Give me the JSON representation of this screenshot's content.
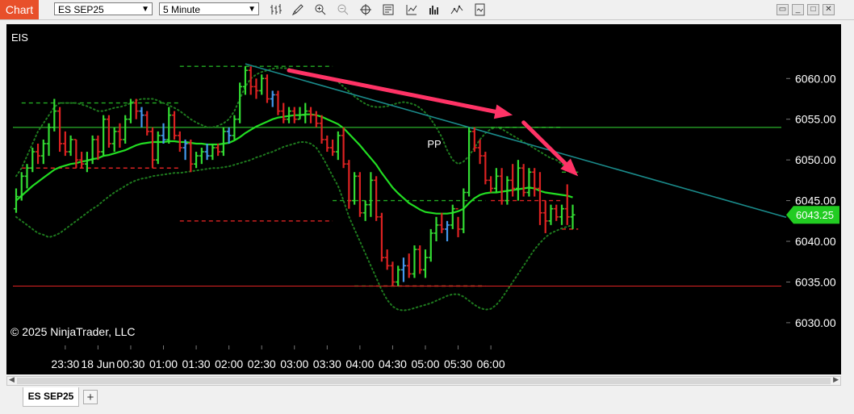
{
  "app": {
    "title": "Chart"
  },
  "toolbar": {
    "instrument": "ES SEP25",
    "period": "5 Minute",
    "icons": [
      "bar-type-icon",
      "drawing-tool-icon",
      "zoom-in-icon",
      "zoom-out-icon",
      "crosshair-icon",
      "data-box-icon",
      "indicators-icon",
      "strategies-icon",
      "chart-trader-icon",
      "templates-icon"
    ],
    "window_buttons": [
      "restore-icon",
      "minimize-icon",
      "maximize-icon",
      "close-icon"
    ]
  },
  "chart": {
    "instrument_label": "EIS",
    "copyright": "© 2025 NinjaTrader, LLC",
    "current_price": "6043.25",
    "pp_label": "PP",
    "colors": {
      "up": "#33dd33",
      "down": "#dd2222",
      "neutral": "#4499ee",
      "sma": "#22dd22",
      "bands": "#1e7a1e",
      "trend": "#1a8a8a",
      "arrow": "#ff3366",
      "price_marker": "#22cc22"
    }
  },
  "chart_data": {
    "type": "candlestick",
    "instrument": "ES SEP25",
    "interval": "5 Minute",
    "x_tick_labels": [
      "23:30",
      "18 Jun",
      "00:30",
      "01:00",
      "01:30",
      "02:00",
      "02:30",
      "03:00",
      "03:30",
      "04:00",
      "04:30",
      "05:00",
      "05:30",
      "06:00"
    ],
    "y_ticks": [
      6030.0,
      6035.0,
      6040.0,
      6045.0,
      6050.0,
      6055.0,
      6060.0
    ],
    "y_tick_labels": [
      "6030.00",
      "6035.00",
      "6040.00",
      "6045.00",
      "6050.00",
      "6055.00",
      "6060.00"
    ],
    "ylim": [
      6028.5,
      6063.5
    ],
    "horizontal_lines": [
      {
        "price": 6054.0,
        "color": "#33dd33",
        "style": "solid"
      },
      {
        "price": 6034.5,
        "color": "#dd2222",
        "style": "solid"
      }
    ],
    "ohlc": [
      [
        6044.0,
        6046.5,
        6043.5,
        6045.5
      ],
      [
        6045.5,
        6048.5,
        6045.0,
        6048.0
      ],
      [
        6048.0,
        6049.5,
        6046.5,
        6049.0
      ],
      [
        6049.0,
        6051.5,
        6048.5,
        6051.0
      ],
      [
        6051.0,
        6052.0,
        6049.5,
        6050.5
      ],
      [
        6050.5,
        6052.5,
        6049.5,
        6052.0
      ],
      [
        6052.0,
        6054.5,
        6050.5,
        6054.0
      ],
      [
        6054.0,
        6057.5,
        6053.5,
        6056.0
      ],
      [
        6056.0,
        6056.5,
        6051.0,
        6052.0
      ],
      [
        6052.0,
        6053.5,
        6050.5,
        6051.0
      ],
      [
        6051.0,
        6053.0,
        6050.5,
        6052.5
      ],
      [
        6052.5,
        6052.5,
        6049.0,
        6050.0
      ],
      [
        6050.0,
        6051.0,
        6049.0,
        6049.5
      ],
      [
        6049.5,
        6051.0,
        6048.5,
        6050.0
      ],
      [
        6050.0,
        6053.0,
        6049.5,
        6052.5
      ],
      [
        6052.5,
        6053.0,
        6050.0,
        6051.0
      ],
      [
        6051.0,
        6055.5,
        6050.5,
        6055.0
      ],
      [
        6055.0,
        6055.5,
        6051.5,
        6052.0
      ],
      [
        6052.0,
        6054.0,
        6051.0,
        6053.5
      ],
      [
        6053.5,
        6054.5,
        6051.5,
        6052.5
      ],
      [
        6052.5,
        6055.5,
        6052.0,
        6055.0
      ],
      [
        6055.0,
        6057.5,
        6054.5,
        6057.0
      ],
      [
        6057.0,
        6057.5,
        6055.0,
        6056.0
      ],
      [
        6056.0,
        6056.5,
        6054.0,
        6055.5
      ],
      [
        6055.5,
        6056.0,
        6053.0,
        6053.5
      ],
      [
        6053.5,
        6054.0,
        6049.0,
        6050.0
      ],
      [
        6050.0,
        6053.5,
        6049.5,
        6053.0
      ],
      [
        6053.0,
        6054.5,
        6052.0,
        6052.5
      ],
      [
        6052.5,
        6056.5,
        6052.0,
        6055.5
      ],
      [
        6055.5,
        6056.0,
        6052.5,
        6053.0
      ],
      [
        6053.0,
        6053.5,
        6051.0,
        6051.5
      ],
      [
        6051.5,
        6052.5,
        6050.0,
        6052.0
      ],
      [
        6052.0,
        6052.5,
        6048.5,
        6049.5
      ],
      [
        6049.5,
        6051.0,
        6049.0,
        6050.5
      ],
      [
        6050.5,
        6051.5,
        6049.5,
        6051.0
      ],
      [
        6051.0,
        6052.0,
        6050.0,
        6050.5
      ],
      [
        6050.5,
        6052.0,
        6050.0,
        6051.5
      ],
      [
        6051.5,
        6052.0,
        6050.5,
        6051.0
      ],
      [
        6051.0,
        6054.0,
        6050.5,
        6053.5
      ],
      [
        6053.5,
        6054.0,
        6052.0,
        6053.0
      ],
      [
        6053.0,
        6055.5,
        6052.5,
        6055.0
      ],
      [
        6055.0,
        6059.5,
        6054.5,
        6059.0
      ],
      [
        6059.0,
        6061.5,
        6058.0,
        6061.0
      ],
      [
        6061.0,
        6061.5,
        6058.0,
        6059.0
      ],
      [
        6059.0,
        6060.0,
        6057.5,
        6058.5
      ],
      [
        6058.5,
        6060.5,
        6058.0,
        6060.0
      ],
      [
        6060.0,
        6060.5,
        6057.0,
        6057.5
      ],
      [
        6057.5,
        6058.5,
        6056.5,
        6058.0
      ],
      [
        6058.0,
        6058.5,
        6055.5,
        6056.0
      ],
      [
        6056.0,
        6057.0,
        6054.5,
        6055.0
      ],
      [
        6055.0,
        6056.5,
        6054.5,
        6056.0
      ],
      [
        6056.0,
        6056.5,
        6054.5,
        6055.0
      ],
      [
        6055.0,
        6056.5,
        6055.0,
        6055.5
      ],
      [
        6055.5,
        6057.0,
        6054.5,
        6056.0
      ],
      [
        6056.0,
        6056.5,
        6054.5,
        6055.5
      ],
      [
        6055.5,
        6056.0,
        6054.0,
        6054.5
      ],
      [
        6054.5,
        6055.5,
        6052.0,
        6052.5
      ],
      [
        6052.5,
        6053.0,
        6051.0,
        6051.5
      ],
      [
        6051.5,
        6052.5,
        6050.5,
        6051.0
      ],
      [
        6051.0,
        6053.5,
        6050.0,
        6053.0
      ],
      [
        6053.0,
        6054.0,
        6049.0,
        6049.5
      ],
      [
        6049.5,
        6050.0,
        6044.0,
        6045.0
      ],
      [
        6045.0,
        6048.5,
        6044.5,
        6048.0
      ],
      [
        6048.0,
        6048.5,
        6043.0,
        6043.5
      ],
      [
        6043.5,
        6045.0,
        6042.5,
        6044.5
      ],
      [
        6044.5,
        6048.5,
        6043.0,
        6047.5
      ],
      [
        6047.5,
        6048.0,
        6042.5,
        6043.0
      ],
      [
        6043.0,
        6043.5,
        6037.5,
        6038.0
      ],
      [
        6038.0,
        6039.0,
        6036.5,
        6037.0
      ],
      [
        6037.0,
        6037.5,
        6034.5,
        6035.0
      ],
      [
        6035.0,
        6037.0,
        6034.5,
        6036.5
      ],
      [
        6036.5,
        6038.0,
        6035.0,
        6037.0
      ],
      [
        6037.0,
        6038.5,
        6035.5,
        6036.0
      ],
      [
        6036.0,
        6039.5,
        6035.5,
        6039.0
      ],
      [
        6039.0,
        6039.5,
        6036.0,
        6036.5
      ],
      [
        6036.5,
        6039.0,
        6035.5,
        6038.0
      ],
      [
        6038.0,
        6041.5,
        6037.5,
        6041.0
      ],
      [
        6041.0,
        6043.0,
        6040.0,
        6042.0
      ],
      [
        6042.0,
        6043.5,
        6041.0,
        6041.5
      ],
      [
        6041.5,
        6042.5,
        6040.0,
        6042.0
      ],
      [
        6042.0,
        6044.5,
        6041.5,
        6044.0
      ],
      [
        6044.0,
        6043.0,
        6040.5,
        6041.5
      ],
      [
        6041.5,
        6046.5,
        6041.0,
        6046.0
      ],
      [
        6046.0,
        6054.0,
        6045.5,
        6053.5
      ],
      [
        6053.5,
        6054.0,
        6051.0,
        6051.5
      ],
      [
        6051.5,
        6052.5,
        6049.5,
        6050.5
      ],
      [
        6050.5,
        6051.0,
        6047.0,
        6047.5
      ],
      [
        6047.5,
        6048.0,
        6046.0,
        6046.5
      ],
      [
        6046.5,
        6049.0,
        6046.0,
        6048.0
      ],
      [
        6048.0,
        6049.0,
        6044.5,
        6045.0
      ],
      [
        6045.0,
        6048.0,
        6044.5,
        6047.5
      ],
      [
        6047.5,
        6049.5,
        6045.5,
        6046.5
      ],
      [
        6046.5,
        6050.0,
        6045.0,
        6049.0
      ],
      [
        6049.0,
        6049.5,
        6045.5,
        6046.0
      ],
      [
        6046.0,
        6049.0,
        6045.5,
        6048.5
      ],
      [
        6048.5,
        6049.0,
        6045.5,
        6046.5
      ],
      [
        6046.5,
        6048.5,
        6042.0,
        6043.5
      ],
      [
        6043.5,
        6045.0,
        6041.0,
        6042.5
      ],
      [
        6042.5,
        6044.5,
        6042.0,
        6044.0
      ],
      [
        6044.0,
        6044.5,
        6042.5,
        6043.0
      ],
      [
        6043.0,
        6044.5,
        6042.0,
        6044.0
      ],
      [
        6044.0,
        6047.0,
        6042.0,
        6043.0
      ],
      [
        6043.0,
        6044.5,
        6041.5,
        6043.25
      ]
    ],
    "sma": [
      6045.0,
      6045.6,
      6046.2,
      6046.8,
      6047.3,
      6047.8,
      6048.3,
      6048.8,
      6049.1,
      6049.3,
      6049.5,
      6049.6,
      6049.8,
      6049.9,
      6050.1,
      6050.2,
      6050.5,
      6050.6,
      6050.8,
      6051.0,
      6051.2,
      6051.5,
      6051.8,
      6052.0,
      6052.1,
      6052.2,
      6052.2,
      6052.2,
      6052.3,
      6052.3,
      6052.2,
      6052.2,
      6052.1,
      6052.0,
      6052.0,
      6051.9,
      6051.9,
      6051.9,
      6052.0,
      6052.1,
      6052.4,
      6052.8,
      6053.3,
      6053.7,
      6054.1,
      6054.4,
      6054.7,
      6055.0,
      6055.2,
      6055.3,
      6055.4,
      6055.5,
      6055.5,
      6055.6,
      6055.6,
      6055.5,
      6055.3,
      6055.0,
      6054.7,
      6054.4,
      6053.9,
      6053.2,
      6052.5,
      6051.8,
      6051.0,
      6050.2,
      6049.4,
      6048.4,
      6047.5,
      6046.6,
      6045.9,
      6045.3,
      6044.7,
      6044.3,
      6043.9,
      6043.6,
      6043.5,
      6043.4,
      6043.4,
      6043.4,
      6043.5,
      6043.7,
      6044.0,
      6044.7,
      6045.3,
      6045.7,
      6045.9,
      6046.0,
      6046.0,
      6046.1,
      6046.2,
      6046.3,
      6046.4,
      6046.5,
      6046.6,
      6046.5,
      6046.2,
      6046.0,
      6045.9,
      6045.8,
      6045.7,
      6045.6,
      6045.4
    ],
    "bb_upper": [
      6048.0,
      6049.0,
      6050.5,
      6052.0,
      6053.5,
      6054.5,
      6055.5,
      6056.5,
      6057.0,
      6057.0,
      6057.0,
      6057.0,
      6056.8,
      6056.6,
      6056.3,
      6056.0,
      6056.0,
      6056.2,
      6056.4,
      6056.5,
      6056.7,
      6057.0,
      6057.3,
      6057.5,
      6057.5,
      6057.5,
      6057.3,
      6057.0,
      6056.7,
      6056.4,
      6056.0,
      6055.5,
      6055.0,
      6054.6,
      6054.3,
      6054.0,
      6054.0,
      6054.2,
      6054.5,
      6055.0,
      6056.0,
      6057.5,
      6059.0,
      6060.0,
      6060.5,
      6060.8,
      6061.0,
      6061.2,
      6061.3,
      6061.3,
      6061.2,
      6061.0,
      6060.8,
      6060.6,
      6060.5,
      6060.4,
      6060.3,
      6060.2,
      6060.0,
      6059.6,
      6059.0,
      6058.4,
      6057.8,
      6057.3,
      6056.9,
      6056.6,
      6056.5,
      6056.5,
      6056.6,
      6056.8,
      6057.0,
      6057.1,
      6057.0,
      6056.8,
      6056.4,
      6055.8,
      6055.0,
      6054.0,
      6052.8,
      6051.2,
      6050.0,
      6049.5,
      6049.8,
      6050.5,
      6051.5,
      6052.5,
      6053.3,
      6053.8,
      6054.0,
      6053.8,
      6053.4,
      6053.0,
      6052.6,
      6052.2,
      6051.8,
      6051.4,
      6051.0,
      6050.6,
      6050.2,
      6050.0,
      6049.5,
      6049.0,
      6048.5
    ],
    "bb_lower": [
      6043.0,
      6042.5,
      6042.0,
      6041.5,
      6041.0,
      6040.8,
      6040.5,
      6040.7,
      6041.0,
      6041.5,
      6042.0,
      6042.5,
      6043.0,
      6043.5,
      6044.0,
      6044.4,
      6045.0,
      6045.5,
      6046.0,
      6046.4,
      6046.8,
      6047.2,
      6047.5,
      6047.7,
      6047.8,
      6048.0,
      6048.1,
      6048.2,
      6048.3,
      6048.4,
      6048.4,
      6048.5,
      6048.6,
      6048.7,
      6048.8,
      6048.9,
      6049.0,
      6049.0,
      6049.1,
      6049.2,
      6049.4,
      6049.6,
      6049.8,
      6050.0,
      6050.3,
      6050.5,
      6050.8,
      6051.0,
      6051.3,
      6051.6,
      6051.8,
      6052.0,
      6052.2,
      6052.2,
      6052.0,
      6051.5,
      6050.5,
      6049.3,
      6048.0,
      6046.8,
      6045.0,
      6043.0,
      6041.5,
      6040.0,
      6038.5,
      6037.0,
      6035.5,
      6034.0,
      6032.8,
      6032.0,
      6031.6,
      6031.5,
      6031.6,
      6031.8,
      6032.0,
      6032.2,
      6032.4,
      6032.7,
      6033.0,
      6033.3,
      6033.5,
      6033.5,
      6033.2,
      6032.7,
      6032.2,
      6031.8,
      6031.6,
      6031.7,
      6032.2,
      6033.0,
      6034.0,
      6035.0,
      6036.0,
      6037.0,
      6038.0,
      6039.0,
      6039.8,
      6040.5,
      6041.0,
      6041.3,
      6041.6,
      6041.8,
      6042.0
    ],
    "dashed_levels": [
      {
        "from": 1,
        "to": 30,
        "price": 6057.0,
        "color": "#22aa22"
      },
      {
        "from": 1,
        "to": 30,
        "price": 6049.0,
        "color": "#dd2222"
      },
      {
        "from": 30,
        "to": 58,
        "price": 6061.5,
        "color": "#22aa22"
      },
      {
        "from": 30,
        "to": 58,
        "price": 6042.5,
        "color": "#dd2222"
      },
      {
        "from": 58,
        "to": 86,
        "price": 6045.0,
        "color": "#22aa22"
      },
      {
        "from": 62,
        "to": 86,
        "price": 6034.5,
        "color": "#22aa22"
      },
      {
        "from": 66,
        "to": 86,
        "price": 6034.5,
        "color": "#dd2222"
      },
      {
        "from": 87,
        "to": 100,
        "price": 6054.0,
        "color": "#22aa22"
      },
      {
        "from": 87,
        "to": 100,
        "price": 6045.0,
        "color": "#dd2222"
      },
      {
        "from": 100,
        "to": 103,
        "price": 6048.5,
        "color": "#22aa22"
      },
      {
        "from": 100,
        "to": 103,
        "price": 6041.5,
        "color": "#dd2222"
      }
    ],
    "trend_line": {
      "from": [
        42,
        6061.8
      ],
      "to": [
        103,
        6050.2
      ]
    },
    "arrows": [
      {
        "from": [
          50,
          6061.0
        ],
        "to": [
          91,
          6055.5
        ]
      },
      {
        "from": [
          93,
          6054.6
        ],
        "to": [
          103,
          6048.0
        ]
      }
    ],
    "pp": {
      "index": 86,
      "price": 6053.5
    }
  }
}
